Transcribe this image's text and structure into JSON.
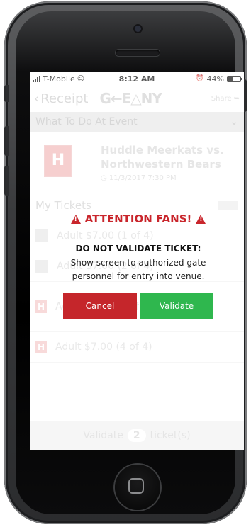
{
  "status_bar": {
    "carrier": "T-Mobile",
    "time": "8:12 AM",
    "battery": "44%",
    "battery_level": 0.44
  },
  "nav": {
    "back_label": "Receipt",
    "share_label": "Share"
  },
  "event_section": {
    "label": "What To Do At Event"
  },
  "event": {
    "logo_letter": "H",
    "title": "Huddle Meerkats vs. Northwestern Bears",
    "datetime": "11/3/2017 7:30 PM"
  },
  "tickets": {
    "heading": "My Tickets",
    "rows": [
      {
        "label": "Adult $7.00 (1 of 4)"
      },
      {
        "label": "Adult $7.00 (2 of 4)"
      },
      {
        "label": "Adult $7.00 (3 of 4)"
      },
      {
        "label": "Adult $7.00 (4 of 4)"
      }
    ]
  },
  "validate_bar": {
    "prefix": "Validate",
    "count": "2",
    "suffix": "ticket(s)"
  },
  "modal": {
    "title": "ATTENTION FANS!",
    "heading": "DO NOT VALIDATE TICKET:",
    "body": "Show screen to authorized gate personnel for entry into venue.",
    "cancel_label": "Cancel",
    "validate_label": "Validate",
    "accent_color": "#c9262c",
    "confirm_color": "#2fb74e"
  }
}
